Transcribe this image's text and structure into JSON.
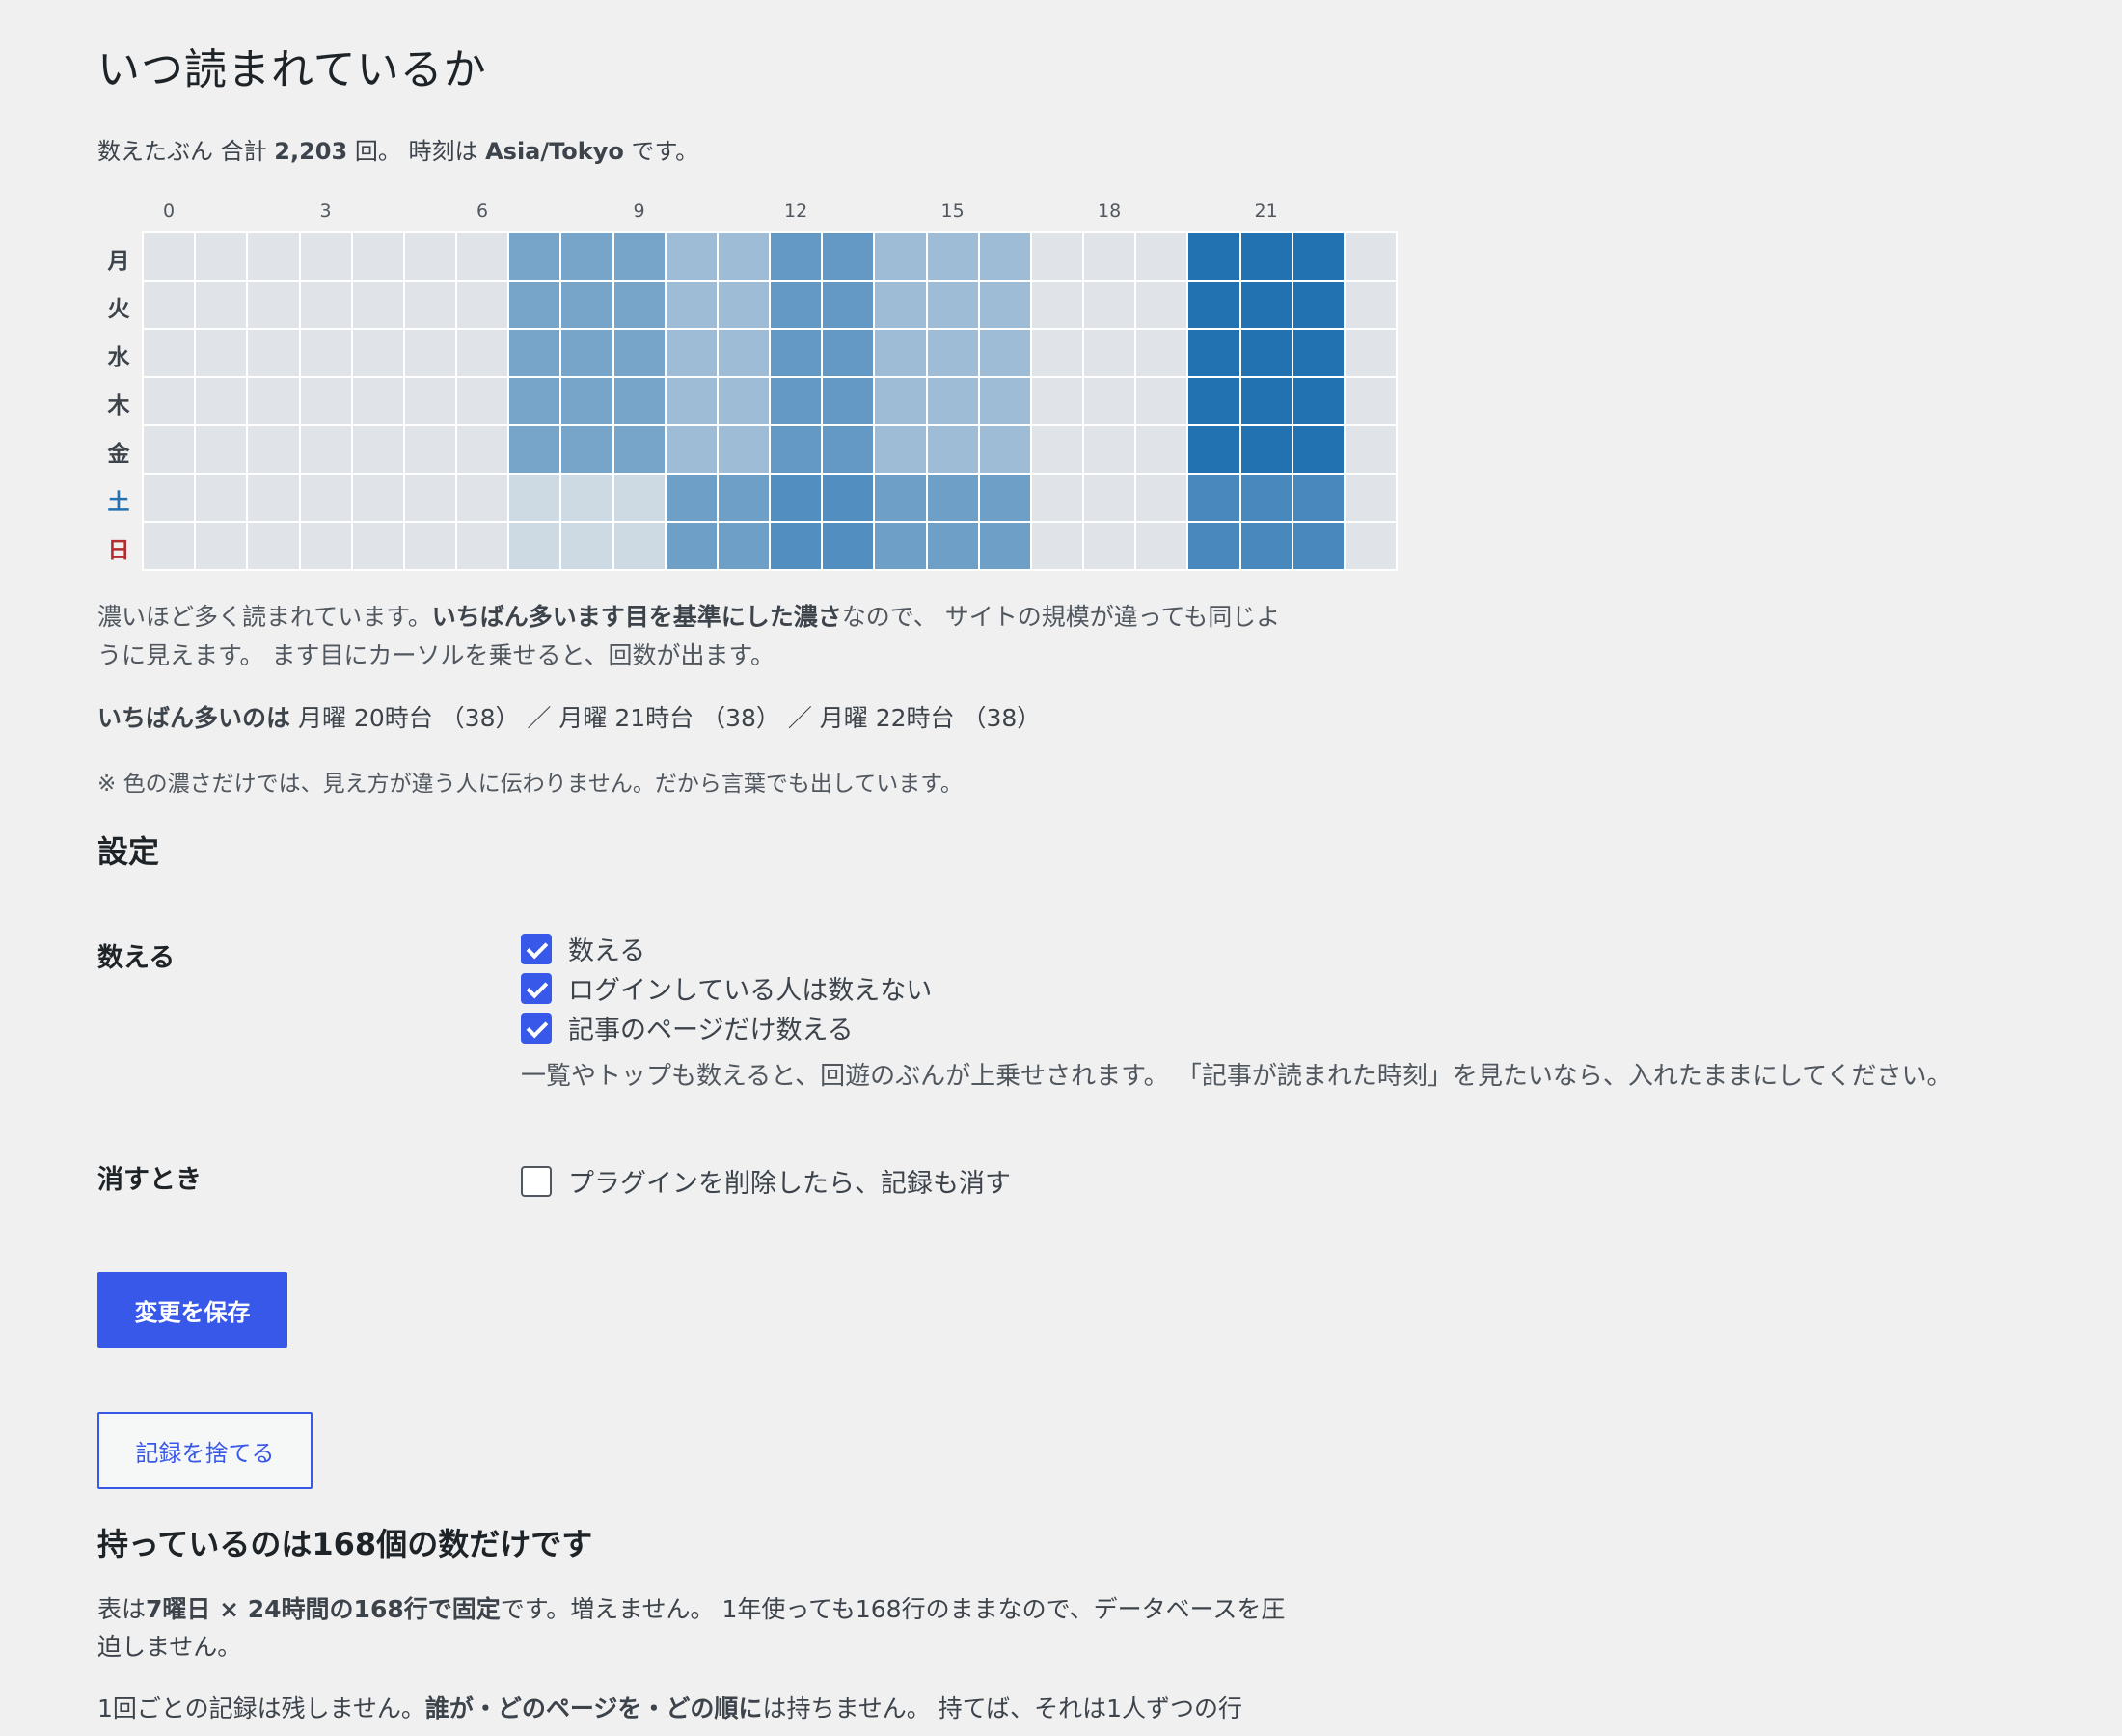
{
  "title": "いつ読まれているか",
  "summary": {
    "pre": "数えたぶん 合計 ",
    "total": "2,203",
    "mid": " 回。 時刻は ",
    "tz": "Asia/Tokyo",
    "post": " です。"
  },
  "heatmap": {
    "hour_labels": [
      "0",
      "3",
      "6",
      "9",
      "12",
      "15",
      "18",
      "21"
    ],
    "days": [
      "月",
      "火",
      "水",
      "木",
      "金",
      "土",
      "日"
    ],
    "day_colors": [
      "#3c434a",
      "#3c434a",
      "#3c434a",
      "#3c434a",
      "#3c434a",
      "#2271b1",
      "#b32d2e"
    ],
    "color_scale": {
      "empty": "#e0e4e9",
      "full": "#2271b1"
    },
    "intensity": [
      [
        0,
        0,
        0,
        0,
        0,
        0,
        0,
        0.55,
        0.55,
        0.55,
        0.35,
        0.35,
        0.65,
        0.65,
        0.35,
        0.35,
        0.35,
        0,
        0,
        0,
        1,
        1,
        1,
        0
      ],
      [
        0,
        0,
        0,
        0,
        0,
        0,
        0,
        0.55,
        0.55,
        0.55,
        0.35,
        0.35,
        0.65,
        0.65,
        0.35,
        0.35,
        0.35,
        0,
        0,
        0,
        1,
        1,
        1,
        0
      ],
      [
        0,
        0,
        0,
        0,
        0,
        0,
        0,
        0.55,
        0.55,
        0.55,
        0.35,
        0.35,
        0.65,
        0.65,
        0.35,
        0.35,
        0.35,
        0,
        0,
        0,
        1,
        1,
        1,
        0
      ],
      [
        0,
        0,
        0,
        0,
        0,
        0,
        0,
        0.55,
        0.55,
        0.55,
        0.35,
        0.35,
        0.65,
        0.65,
        0.35,
        0.35,
        0.35,
        0,
        0,
        0,
        1,
        1,
        1,
        0
      ],
      [
        0,
        0,
        0,
        0,
        0,
        0,
        0,
        0.55,
        0.55,
        0.55,
        0.35,
        0.35,
        0.65,
        0.65,
        0.35,
        0.35,
        0.35,
        0,
        0,
        0,
        1,
        1,
        1,
        0
      ],
      [
        0,
        0,
        0,
        0,
        0,
        0,
        0,
        0.1,
        0.1,
        0.1,
        0.6,
        0.6,
        0.75,
        0.75,
        0.6,
        0.6,
        0.6,
        0,
        0,
        0,
        0.8,
        0.8,
        0.8,
        0
      ],
      [
        0,
        0,
        0,
        0,
        0,
        0,
        0,
        0.1,
        0.1,
        0.1,
        0.6,
        0.6,
        0.75,
        0.75,
        0.6,
        0.6,
        0.6,
        0,
        0,
        0,
        0.8,
        0.8,
        0.8,
        0
      ]
    ]
  },
  "note1": {
    "pre": "濃いほど多く読まれています。",
    "bold": "いちばん多います目を基準にした濃さ",
    "post": "なので、 サイトの規模が違っても同じように見えます。 ます目にカーソルを乗せると、回数が出ます。"
  },
  "peak": {
    "label": "いちばん多いのは",
    "text": " 月曜 20時台 （38） ／ 月曜 21時台 （38） ／ 月曜 22時台 （38）"
  },
  "caution": "※ 色の濃さだけでは、見え方が違う人に伝わりません。だから言葉でも出しています。",
  "settings": {
    "heading": "設定",
    "count_label": "数える",
    "count_options": [
      {
        "label": "数える",
        "checked": true
      },
      {
        "label": "ログインしている人は数えない",
        "checked": true
      },
      {
        "label": "記事のページだけ数える",
        "checked": true
      }
    ],
    "count_desc": "一覧やトップも数えると、回遊のぶんが上乗せされます。 「記事が読まれた時刻」を見たいなら、入れたままにしてください。",
    "delete_label": "消すとき",
    "delete_option": {
      "label": "プラグインを削除したら、記録も消す",
      "checked": false
    }
  },
  "buttons": {
    "save": "変更を保存",
    "discard": "記録を捨てる"
  },
  "storage": {
    "heading": "持っているのは168個の数だけです",
    "p1_pre": "表は",
    "p1_bold": "7曜日 × 24時間の168行で固定",
    "p1_post": "です。増えません。 1年使っても168行のままなので、データベースを圧迫しません。",
    "p2_pre": "1回ごとの記録は残しません。",
    "p2_bold": "誰が・どのページを・どの順に",
    "p2_post": "は持ちません。 持てば、それは1人ずつの行"
  }
}
